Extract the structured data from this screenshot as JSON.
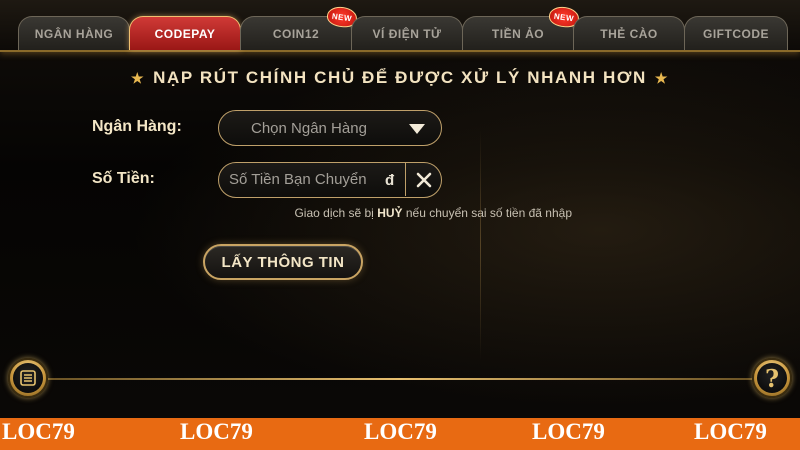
{
  "tabs": [
    {
      "label": "NGÂN HÀNG",
      "active": false,
      "badge": ""
    },
    {
      "label": "CODEPAY",
      "active": true,
      "badge": ""
    },
    {
      "label": "COIN12",
      "active": false,
      "badge": "NEW"
    },
    {
      "label": "VÍ ĐIỆN TỬ",
      "active": false,
      "badge": ""
    },
    {
      "label": "TIỀN ẢO",
      "active": false,
      "badge": "NEW"
    },
    {
      "label": "THẺ CÀO",
      "active": false,
      "badge": ""
    },
    {
      "label": "GIFTCODE",
      "active": false,
      "badge": ""
    }
  ],
  "headline": "NẠP RÚT CHÍNH CHỦ ĐỂ ĐƯỢC XỬ LÝ NHANH HƠN",
  "form": {
    "bank_label": "Ngân Hàng:",
    "bank_select_value": "Chọn Ngân Hàng",
    "amount_label": "Số Tiền:",
    "amount_placeholder": "Số Tiền Bạn Chuyển",
    "currency_symbol": "đ",
    "note_prefix": "Giao dịch sẽ bị ",
    "note_strong": "HUỶ",
    "note_suffix": " nếu chuyển sai số tiền đã nhập",
    "submit_label": "LẤY THÔNG TIN"
  },
  "icons": {
    "menu": "list-icon",
    "help": "question-icon",
    "clear": "close-icon",
    "dropdown": "caret-down-icon",
    "star": "star-icon"
  },
  "help_glyph": "?",
  "watermark": "LOC79",
  "colors": {
    "active_tab": "#c02a28",
    "gold": "#c9a463",
    "footer": "#e86a12"
  }
}
